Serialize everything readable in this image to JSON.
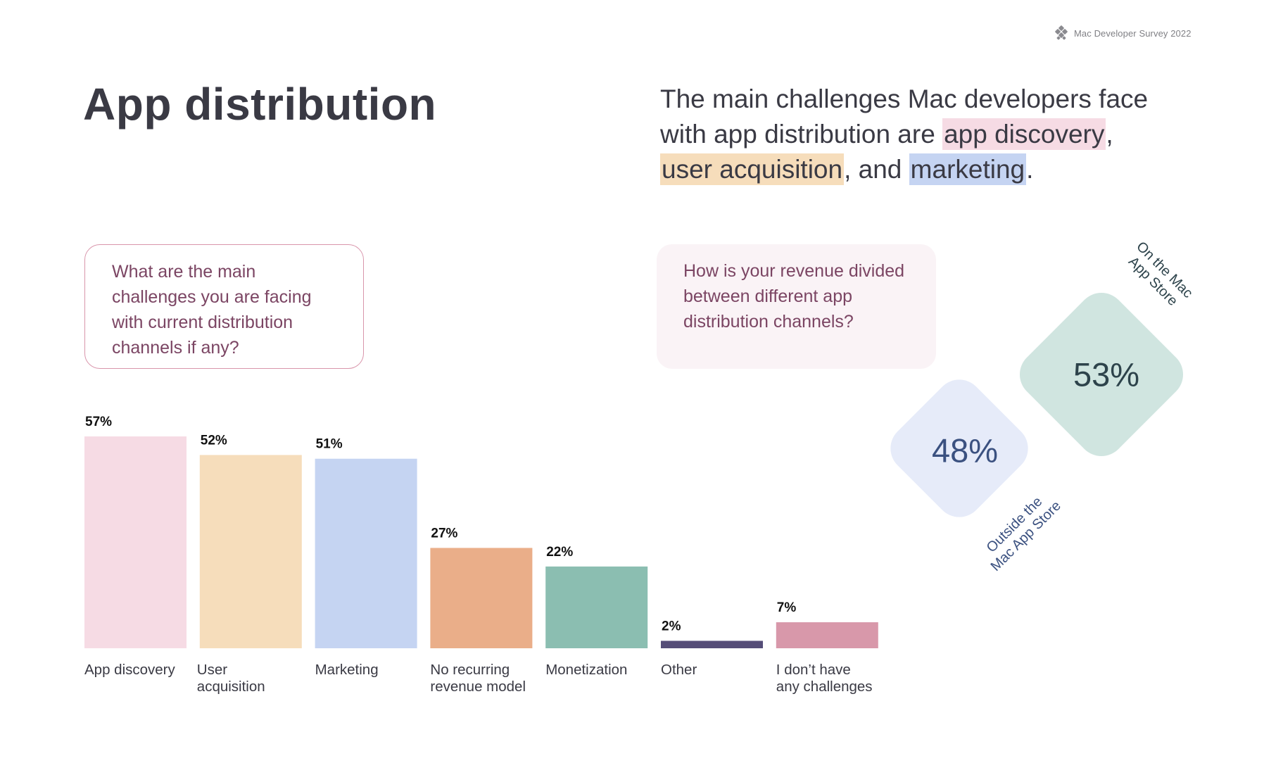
{
  "header": {
    "brand_icon": "survey-logo-icon",
    "brand_text": "Mac Developer Survey 2022"
  },
  "title": "App distribution",
  "summary": {
    "prefix": "The main challenges Mac developers face with app distribution are ",
    "highlight_1": "app discovery",
    "sep_1": ", ",
    "highlight_2": "user acquisition",
    "sep_2": ", and ",
    "highlight_3": "marketing",
    "suffix": ".",
    "highlight_colors": [
      "#f6dbe4",
      "#f6ddbb",
      "#c5d4f2"
    ]
  },
  "questions": {
    "challenges": "What are the main challenges you are facing with current distribution channels if any?",
    "revenue": "How is your revenue divided between different app distribution channels?"
  },
  "revenue_split": {
    "on_store": {
      "value": "53%",
      "label_lines": [
        "On the Mac",
        "App Store"
      ],
      "color": "#d0e5e0"
    },
    "outside_store": {
      "value": "48%",
      "label_lines": [
        "Outside the",
        "Mac App Store"
      ],
      "color": "#e6ebf9"
    }
  },
  "chart_data": [
    {
      "type": "bar",
      "title": "What are the main challenges you are facing with current distribution channels if any?",
      "xlabel": "",
      "ylabel": "",
      "ylim": [
        0,
        57
      ],
      "grid": false,
      "legend": "none",
      "categories": [
        [
          "App discovery"
        ],
        [
          "User",
          "acquisition"
        ],
        [
          "Marketing"
        ],
        [
          "No recurring",
          "revenue model"
        ],
        [
          "Monetization"
        ],
        [
          "Other"
        ],
        [
          "I don’t have",
          "any challenges"
        ]
      ],
      "values": [
        57,
        52,
        51,
        27,
        22,
        2,
        7
      ],
      "value_labels": [
        "57%",
        "52%",
        "51%",
        "27%",
        "22%",
        "2%",
        "7%"
      ],
      "colors": [
        "#f6dbe4",
        "#f6ddbb",
        "#c5d4f2",
        "#eaae89",
        "#8bbeb1",
        "#554d78",
        "#d898aa"
      ]
    },
    {
      "type": "pie",
      "title": "How is your revenue divided between different app distribution channels?",
      "categories": [
        "On the Mac App Store",
        "Outside the Mac App Store"
      ],
      "values": [
        53,
        48
      ],
      "value_labels": [
        "53%",
        "48%"
      ]
    }
  ]
}
